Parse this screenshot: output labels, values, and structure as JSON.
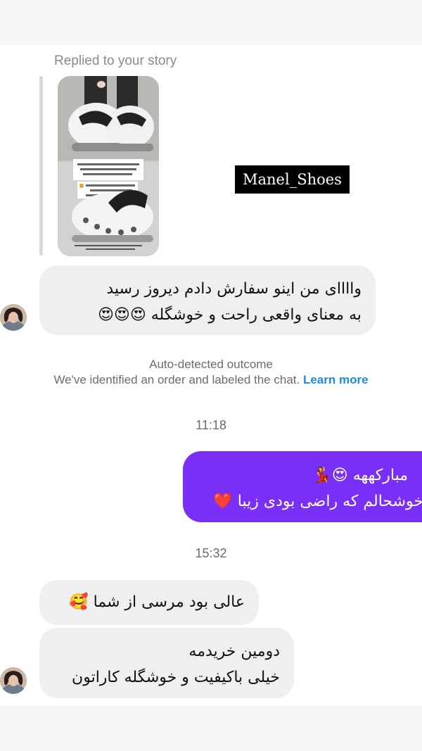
{
  "colors": {
    "incoming_bubble": "#efeff1",
    "outgoing_bubble": "#7a2ff7",
    "link": "#1d8ddb",
    "muted_text": "#6b6b70"
  },
  "story_reply": {
    "caption": "Replied to your story",
    "shop_tag": "Manel_Shoes"
  },
  "messages": [
    {
      "direction": "incoming",
      "lines": [
        "واااای من اینو سفارش دادم دیروز رسید",
        "به معنای واقعی راحت و خوشگله 😍😍😍"
      ]
    },
    {
      "direction": "outgoing",
      "lines": [
        "مبارکههه 😍💃",
        "خوشحالم که راضی بودی زیبا ❤️"
      ]
    },
    {
      "direction": "incoming",
      "lines": [
        "عالی بود مرسی  از شما 🥰"
      ]
    },
    {
      "direction": "incoming",
      "lines": [
        "دومین خریدمه",
        "خیلی باکیفیت و خوشگله کاراتون"
      ]
    }
  ],
  "system_notice": {
    "title": "Auto-detected outcome",
    "body": "We've identified an order and labeled the chat.",
    "link": "Learn more"
  },
  "timestamps": [
    "11:18",
    "15:32"
  ]
}
